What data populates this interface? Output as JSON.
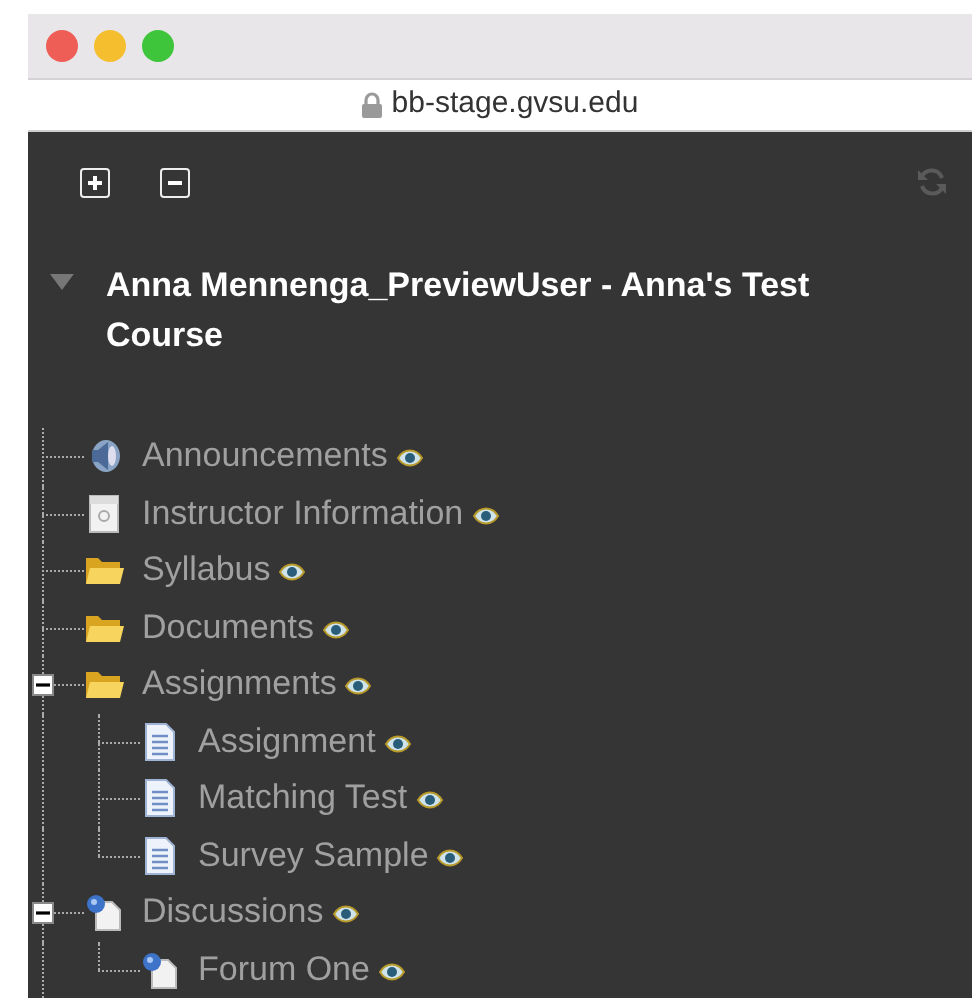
{
  "browser": {
    "address": "bb-stage.gvsu.edu"
  },
  "course_menu": {
    "title": "Anna Mennenga_PreviewUser - Anna's Test Course",
    "expanded": true
  },
  "tree": [
    {
      "label": "Announcements",
      "kind": "announcement"
    },
    {
      "label": "Instructor Information",
      "kind": "info"
    },
    {
      "label": "Syllabus",
      "kind": "folder"
    },
    {
      "label": "Documents",
      "kind": "folder"
    },
    {
      "label": "Assignments",
      "kind": "folder",
      "expanded": true,
      "children": [
        {
          "label": "Assignment",
          "kind": "document"
        },
        {
          "label": "Matching Test",
          "kind": "document"
        },
        {
          "label": "Survey Sample",
          "kind": "document"
        }
      ]
    },
    {
      "label": "Discussions",
      "kind": "discussion",
      "expanded": true,
      "children": [
        {
          "label": "Forum One",
          "kind": "discussion"
        }
      ]
    }
  ]
}
